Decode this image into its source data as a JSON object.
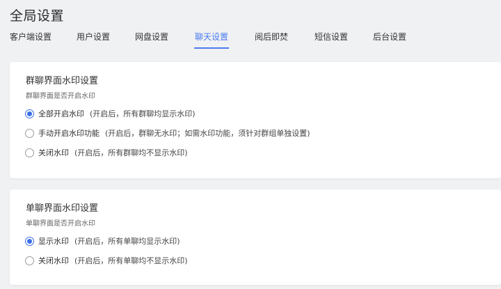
{
  "page": {
    "title": "全局设置"
  },
  "tabs": [
    {
      "label": "客户端设置"
    },
    {
      "label": "用户设置"
    },
    {
      "label": "网盘设置"
    },
    {
      "label": "聊天设置",
      "active": true
    },
    {
      "label": "阅后即焚"
    },
    {
      "label": "短信设置"
    },
    {
      "label": "后台设置"
    }
  ],
  "colors": {
    "accent": "#4a7cf0",
    "background": "#f0f1f3",
    "card": "#ffffff"
  },
  "group_watermark": {
    "title": "群聊界面水印设置",
    "subtitle": "群聊界面是否开启水印",
    "options": [
      {
        "label": "全部开启水印",
        "desc": "(开启后，所有群聊均显示水印)",
        "checked": true
      },
      {
        "label": "手动开启水印功能",
        "desc": "(开启后，群聊无水印；如需水印功能，须针对群组单独设置)",
        "checked": false
      },
      {
        "label": "关闭水印",
        "desc": "(开启后，所有群聊均不显示水印)",
        "checked": false
      }
    ]
  },
  "single_watermark": {
    "title": "单聊界面水印设置",
    "subtitle": "单聊界面是否开启水印",
    "options": [
      {
        "label": "显示水印",
        "desc": "(开启后，所有单聊均显示水印)",
        "checked": true
      },
      {
        "label": "关闭水印",
        "desc": "(开启后，所有单聊均不显示水印)",
        "checked": false
      }
    ]
  }
}
